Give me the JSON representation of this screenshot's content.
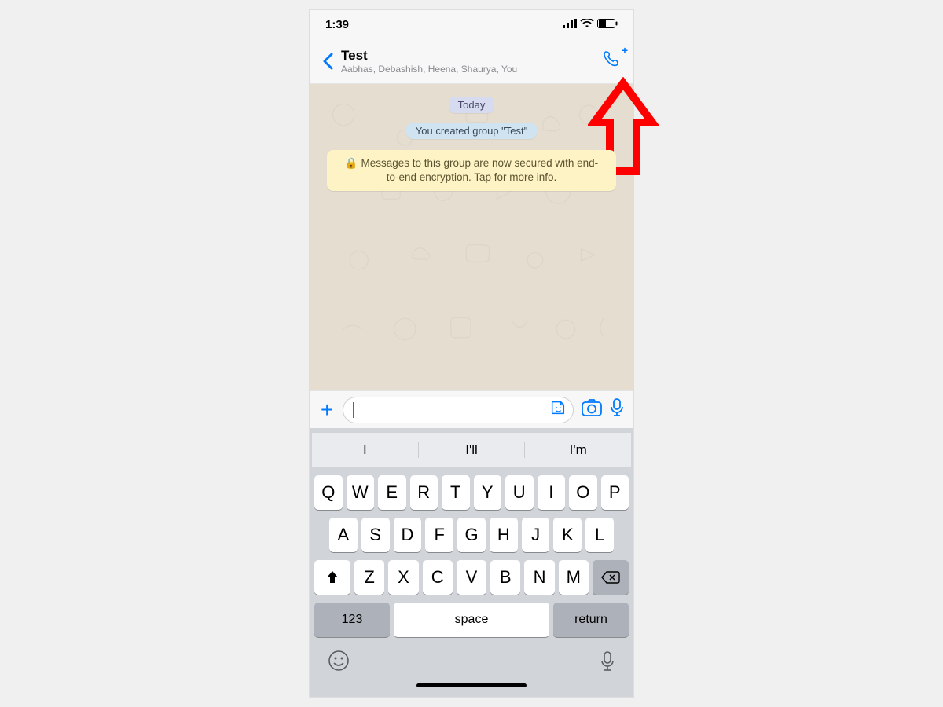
{
  "status": {
    "time": "1:39"
  },
  "nav": {
    "title": "Test",
    "subtitle": "Aabhas, Debashish, Heena, Shaurya, You"
  },
  "chat": {
    "date_label": "Today",
    "system_msg": "You created group \"Test\"",
    "encryption_notice": "Messages to this group are now secured with end-to-end encryption. Tap for more info."
  },
  "keyboard": {
    "suggestions": [
      "I",
      "I'll",
      "I'm"
    ],
    "rows": [
      [
        "Q",
        "W",
        "E",
        "R",
        "T",
        "Y",
        "U",
        "I",
        "O",
        "P"
      ],
      [
        "A",
        "S",
        "D",
        "F",
        "G",
        "H",
        "J",
        "K",
        "L"
      ],
      [
        "Z",
        "X",
        "C",
        "V",
        "B",
        "N",
        "M"
      ]
    ],
    "numeric_label": "123",
    "space_label": "space",
    "return_label": "return"
  }
}
